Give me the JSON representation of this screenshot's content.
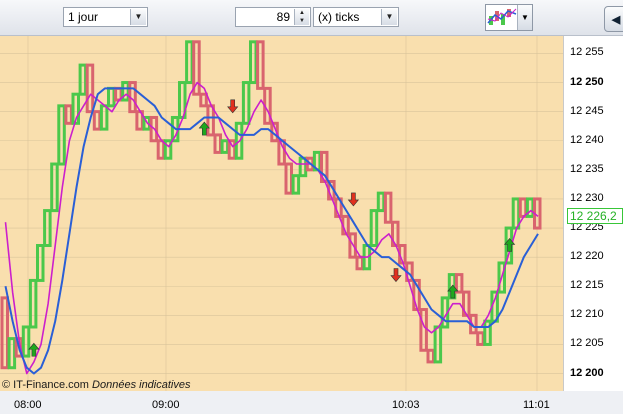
{
  "toolbar": {
    "period_value": "1 jour",
    "count_value": "89",
    "unit_value": "(x) ticks",
    "collapse_glyph": "◀"
  },
  "watermark": {
    "source": "© IT-Finance.com",
    "note": "Données indicatives"
  },
  "last_price": "12 226,2",
  "colors": {
    "plot_bg": "#f9dfae",
    "grid": "#d9c49a",
    "up_box": "#4bc84b",
    "down_box": "#d9646e",
    "ma_fast": "#cc1fcc",
    "ma_slow": "#2a5fd6",
    "signal_up": "#1ea81e",
    "signal_down": "#e0301e"
  },
  "chart_data": {
    "type": "line",
    "ylim": [
      12197,
      12258
    ],
    "yticks": [
      12255,
      12250,
      12245,
      12240,
      12235,
      12230,
      12225,
      12220,
      12215,
      12210,
      12205,
      12200
    ],
    "ytick_labels": [
      "12 255",
      "12 250",
      "12 245",
      "12 240",
      "12 235",
      "12 230",
      "12 225",
      "12 220",
      "12 215",
      "12 210",
      "12 205",
      "12 200"
    ],
    "bold_yticks": [
      "12 250",
      "12 200"
    ],
    "xticks": [
      "08:00",
      "09:00",
      "10:03",
      "11:01"
    ],
    "boxes": [
      {
        "dir": "down",
        "o": 12213,
        "c": 12201
      },
      {
        "dir": "up",
        "o": 12201,
        "c": 12206
      },
      {
        "dir": "down",
        "o": 12206,
        "c": 12203
      },
      {
        "dir": "up",
        "o": 12203,
        "c": 12208
      },
      {
        "dir": "up",
        "o": 12208,
        "c": 12216
      },
      {
        "dir": "up",
        "o": 12216,
        "c": 12222
      },
      {
        "dir": "up",
        "o": 12222,
        "c": 12228
      },
      {
        "dir": "up",
        "o": 12228,
        "c": 12236
      },
      {
        "dir": "up",
        "o": 12236,
        "c": 12246
      },
      {
        "dir": "down",
        "o": 12246,
        "c": 12243
      },
      {
        "dir": "up",
        "o": 12243,
        "c": 12248
      },
      {
        "dir": "up",
        "o": 12248,
        "c": 12253
      },
      {
        "dir": "down",
        "o": 12253,
        "c": 12245
      },
      {
        "dir": "down",
        "o": 12245,
        "c": 12242
      },
      {
        "dir": "up",
        "o": 12242,
        "c": 12246
      },
      {
        "dir": "up",
        "o": 12246,
        "c": 12249
      },
      {
        "dir": "down",
        "o": 12249,
        "c": 12247
      },
      {
        "dir": "up",
        "o": 12247,
        "c": 12250
      },
      {
        "dir": "down",
        "o": 12250,
        "c": 12245
      },
      {
        "dir": "down",
        "o": 12245,
        "c": 12242
      },
      {
        "dir": "up",
        "o": 12242,
        "c": 12244
      },
      {
        "dir": "down",
        "o": 12244,
        "c": 12240
      },
      {
        "dir": "down",
        "o": 12240,
        "c": 12237
      },
      {
        "dir": "up",
        "o": 12237,
        "c": 12240
      },
      {
        "dir": "up",
        "o": 12240,
        "c": 12244
      },
      {
        "dir": "up",
        "o": 12244,
        "c": 12250
      },
      {
        "dir": "up",
        "o": 12250,
        "c": 12257
      },
      {
        "dir": "down",
        "o": 12257,
        "c": 12248
      },
      {
        "dir": "down",
        "o": 12248,
        "c": 12246
      },
      {
        "dir": "down",
        "o": 12246,
        "c": 12241
      },
      {
        "dir": "down",
        "o": 12241,
        "c": 12238
      },
      {
        "dir": "up",
        "o": 12238,
        "c": 12240
      },
      {
        "dir": "down",
        "o": 12240,
        "c": 12237
      },
      {
        "dir": "up",
        "o": 12237,
        "c": 12243
      },
      {
        "dir": "up",
        "o": 12243,
        "c": 12250
      },
      {
        "dir": "up",
        "o": 12250,
        "c": 12257
      },
      {
        "dir": "down",
        "o": 12257,
        "c": 12249
      },
      {
        "dir": "down",
        "o": 12249,
        "c": 12243
      },
      {
        "dir": "down",
        "o": 12243,
        "c": 12240
      },
      {
        "dir": "down",
        "o": 12240,
        "c": 12236
      },
      {
        "dir": "down",
        "o": 12236,
        "c": 12231
      },
      {
        "dir": "up",
        "o": 12231,
        "c": 12234
      },
      {
        "dir": "up",
        "o": 12234,
        "c": 12237
      },
      {
        "dir": "down",
        "o": 12237,
        "c": 12235
      },
      {
        "dir": "up",
        "o": 12235,
        "c": 12238
      },
      {
        "dir": "down",
        "o": 12238,
        "c": 12233
      },
      {
        "dir": "down",
        "o": 12233,
        "c": 12230
      },
      {
        "dir": "down",
        "o": 12230,
        "c": 12227
      },
      {
        "dir": "down",
        "o": 12227,
        "c": 12224
      },
      {
        "dir": "down",
        "o": 12224,
        "c": 12220
      },
      {
        "dir": "down",
        "o": 12220,
        "c": 12218
      },
      {
        "dir": "up",
        "o": 12218,
        "c": 12222
      },
      {
        "dir": "up",
        "o": 12222,
        "c": 12228
      },
      {
        "dir": "up",
        "o": 12228,
        "c": 12231
      },
      {
        "dir": "down",
        "o": 12231,
        "c": 12226
      },
      {
        "dir": "down",
        "o": 12226,
        "c": 12222
      },
      {
        "dir": "down",
        "o": 12222,
        "c": 12219
      },
      {
        "dir": "down",
        "o": 12219,
        "c": 12216
      },
      {
        "dir": "down",
        "o": 12216,
        "c": 12211
      },
      {
        "dir": "down",
        "o": 12211,
        "c": 12204
      },
      {
        "dir": "down",
        "o": 12204,
        "c": 12202
      },
      {
        "dir": "up",
        "o": 12202,
        "c": 12208
      },
      {
        "dir": "up",
        "o": 12208,
        "c": 12213
      },
      {
        "dir": "up",
        "o": 12213,
        "c": 12217
      },
      {
        "dir": "down",
        "o": 12217,
        "c": 12214
      },
      {
        "dir": "down",
        "o": 12214,
        "c": 12210
      },
      {
        "dir": "down",
        "o": 12210,
        "c": 12207
      },
      {
        "dir": "down",
        "o": 12207,
        "c": 12205
      },
      {
        "dir": "up",
        "o": 12205,
        "c": 12209
      },
      {
        "dir": "up",
        "o": 12209,
        "c": 12214
      },
      {
        "dir": "up",
        "o": 12214,
        "c": 12219
      },
      {
        "dir": "up",
        "o": 12219,
        "c": 12225
      },
      {
        "dir": "up",
        "o": 12225,
        "c": 12230
      },
      {
        "dir": "down",
        "o": 12230,
        "c": 12227
      },
      {
        "dir": "up",
        "o": 12227,
        "c": 12230
      },
      {
        "dir": "down",
        "o": 12230,
        "c": 12225
      }
    ],
    "series": [
      {
        "name": "",
        "role": "fast",
        "values": [
          12226,
          12214,
          12205,
          12200,
          12202,
          12205,
          12212,
          12222,
          12232,
          12240,
          12244,
          12246,
          12248,
          12247,
          12246,
          12245,
          12247,
          12248,
          12247,
          12245,
          12243,
          12242,
          12240,
          12239,
          12241,
          12244,
          12248,
          12250,
          12249,
          12246,
          12244,
          12241,
          12239,
          12240,
          12242,
          12245,
          12247,
          12245,
          12242,
          12239,
          12237,
          12236,
          12236,
          12236,
          12235,
          12233,
          12230,
          12227,
          12224,
          12222,
          12220,
          12220,
          12221,
          12223,
          12224,
          12222,
          12219,
          12215,
          12211,
          12208,
          12207,
          12208,
          12210,
          12212,
          12212,
          12210,
          12208,
          12208,
          12210,
          12213,
          12217,
          12221,
          12225,
          12227,
          12228,
          12227
        ]
      },
      {
        "name": "",
        "role": "slow",
        "values": [
          12215,
          12209,
          12204,
          12201,
          12200,
          12201,
          12204,
          12209,
          12216,
          12224,
          12232,
          12239,
          12244,
          12248,
          12249,
          12249,
          12249,
          12249,
          12249,
          12248,
          12247,
          12246,
          12244,
          12243,
          12242,
          12242,
          12242,
          12243,
          12244,
          12244,
          12244,
          12243,
          12242,
          12241,
          12241,
          12241,
          12242,
          12242,
          12241,
          12240,
          12239,
          12238,
          12237,
          12236,
          12235,
          12234,
          12232,
          12230,
          12228,
          12226,
          12224,
          12222,
          12221,
          12220,
          12220,
          12219,
          12218,
          12217,
          12215,
          12213,
          12211,
          12210,
          12209,
          12209,
          12209,
          12209,
          12208,
          12208,
          12208,
          12209,
          12211,
          12214,
          12217,
          12220,
          12222,
          12224
        ]
      }
    ],
    "signals": [
      {
        "dir": "up",
        "i": 4,
        "y": 12204
      },
      {
        "dir": "up",
        "i": 28,
        "y": 12242
      },
      {
        "dir": "down",
        "i": 32,
        "y": 12246
      },
      {
        "dir": "down",
        "i": 49,
        "y": 12230
      },
      {
        "dir": "down",
        "i": 55,
        "y": 12217
      },
      {
        "dir": "up",
        "i": 63,
        "y": 12214
      },
      {
        "dir": "up",
        "i": 71,
        "y": 12222
      }
    ]
  }
}
